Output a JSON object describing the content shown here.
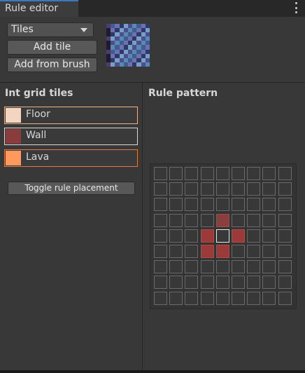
{
  "window": {
    "tab_title": "Rule editor"
  },
  "toolbar": {
    "dropdown_value": "Tiles",
    "add_tile_label": "Add tile",
    "add_from_brush_label": "Add from brush"
  },
  "int_grid": {
    "title": "Int grid tiles",
    "tiles": [
      {
        "label": "Floor",
        "color": "#f2d6c1",
        "border": "#e6b68f"
      },
      {
        "label": "Wall",
        "color": "#8a3c3c",
        "border": "#d9d9d9"
      },
      {
        "label": "Lava",
        "color": "#ff9a5c",
        "border": "#e07a46"
      }
    ],
    "toggle_label": "Toggle rule placement"
  },
  "rule_pattern": {
    "title": "Rule pattern",
    "grid_size": 9,
    "filled_cells": [
      [
        3,
        4
      ],
      [
        4,
        3
      ],
      [
        4,
        5
      ],
      [
        5,
        3
      ],
      [
        5,
        4
      ]
    ],
    "center_cell": [
      4,
      4
    ]
  },
  "icons": {
    "menu": "kebab-menu-icon",
    "dropdown": "chevron-down-icon"
  }
}
